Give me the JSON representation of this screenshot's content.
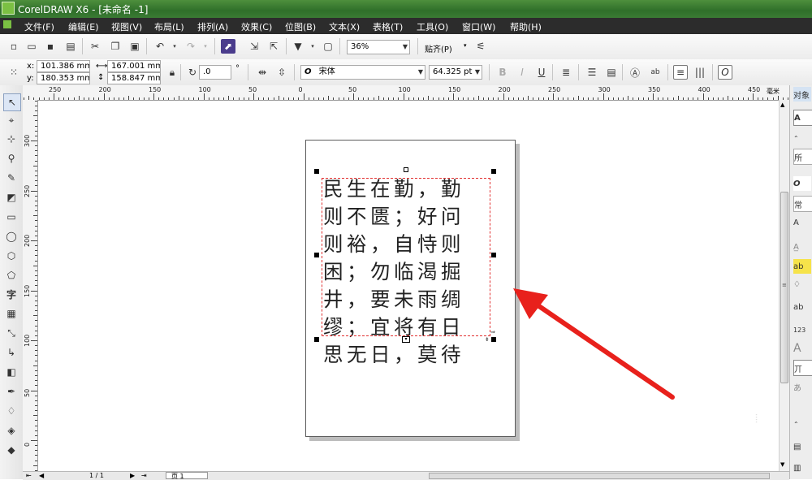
{
  "window": {
    "title": "CorelDRAW X6 - [未命名 -1]"
  },
  "menu": [
    {
      "label": "文件(F)"
    },
    {
      "label": "编辑(E)"
    },
    {
      "label": "视图(V)"
    },
    {
      "label": "布局(L)"
    },
    {
      "label": "排列(A)"
    },
    {
      "label": "效果(C)"
    },
    {
      "label": "位图(B)"
    },
    {
      "label": "文本(X)"
    },
    {
      "label": "表格(T)"
    },
    {
      "label": "工具(O)"
    },
    {
      "label": "窗口(W)"
    },
    {
      "label": "帮助(H)"
    }
  ],
  "standard_toolbar": {
    "zoom": "36%",
    "snap_label": "贴齐(P)"
  },
  "property_bar": {
    "x_label": "x:",
    "x_value": "101.386 mm",
    "y_label": "y:",
    "y_value": "180.353 mm",
    "width_value": "167.001 mm",
    "height_value": "158.847 mm",
    "rotation": ".0",
    "degree_sign": "°",
    "font_icon": "O",
    "font_name": "宋体",
    "font_size": "64.325 pt"
  },
  "ruler": {
    "unit": "毫米",
    "h_labels": [
      "250",
      "200",
      "150",
      "100",
      "50",
      "0",
      "50",
      "100",
      "150",
      "200",
      "250",
      "300",
      "350",
      "400",
      "450"
    ],
    "v_labels": [
      "300",
      "250",
      "200",
      "150",
      "100",
      "50",
      "0"
    ]
  },
  "document": {
    "text_lines": [
      "民生在勤，勤",
      "则不匮；好问",
      "则裕，自恃则",
      "困；勿临渴掘",
      "井，要未雨绸",
      "缪；宜将有日",
      "思无日，莫待"
    ]
  },
  "docker": {
    "title": "对象",
    "items": [
      "A",
      "所",
      "O",
      "常",
      "A",
      "ab",
      "ab",
      "123",
      "A",
      "丌",
      "あ"
    ]
  },
  "status": {
    "page_counter": "1 / 1",
    "page_tab": "页 1"
  },
  "colors": {
    "accent_arrow": "#e8211c",
    "title_green": "#3a7b33",
    "selection_red": "#e23232"
  }
}
